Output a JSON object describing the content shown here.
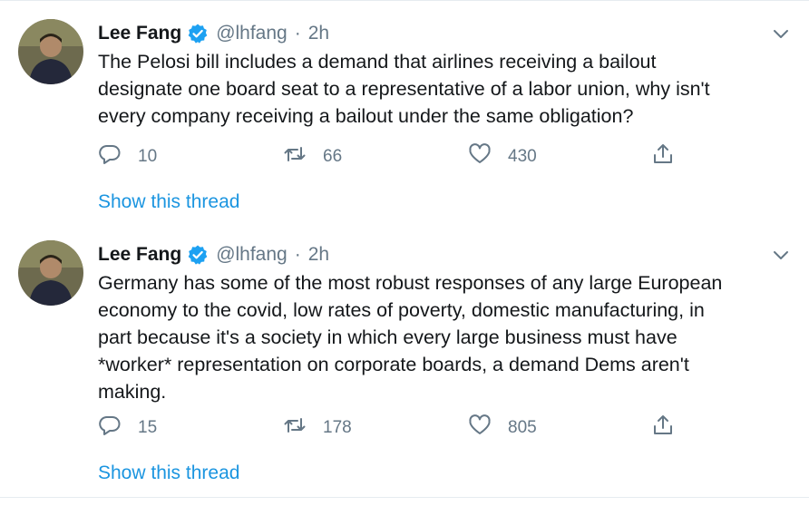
{
  "colors": {
    "link": "#1b95e0",
    "secondary": "#657786",
    "verified": "#1da1f2"
  },
  "tweets": [
    {
      "author": {
        "name": "Lee Fang",
        "handle": "@lhfang",
        "verified": true
      },
      "separator": "·",
      "time": "2h",
      "text": "The Pelosi bill includes a demand that airlines receiving a bailout\ndesignate one board seat to a representative of a labor union, why isn't\nevery company receiving a bailout under the same obligation?",
      "actions": {
        "replies": "10",
        "retweets": "66",
        "likes": "430"
      },
      "show_thread": "Show this thread",
      "icons": [
        "reply-icon",
        "retweet-icon",
        "like-icon",
        "share-icon",
        "chevron-down-icon",
        "verified-badge-icon"
      ]
    },
    {
      "author": {
        "name": "Lee Fang",
        "handle": "@lhfang",
        "verified": true
      },
      "separator": "·",
      "time": "2h",
      "text": "Germany has some of the most robust responses of any large European\neconomy to the covid, low rates of poverty, domestic manufacturing, in\npart because it's a society in which every large business must have\n*worker* representation on corporate boards, a demand Dems aren't\nmaking.",
      "actions": {
        "replies": "15",
        "retweets": "178",
        "likes": "805"
      },
      "show_thread": "Show this thread",
      "icons": [
        "reply-icon",
        "retweet-icon",
        "like-icon",
        "share-icon",
        "chevron-down-icon",
        "verified-badge-icon"
      ]
    }
  ]
}
